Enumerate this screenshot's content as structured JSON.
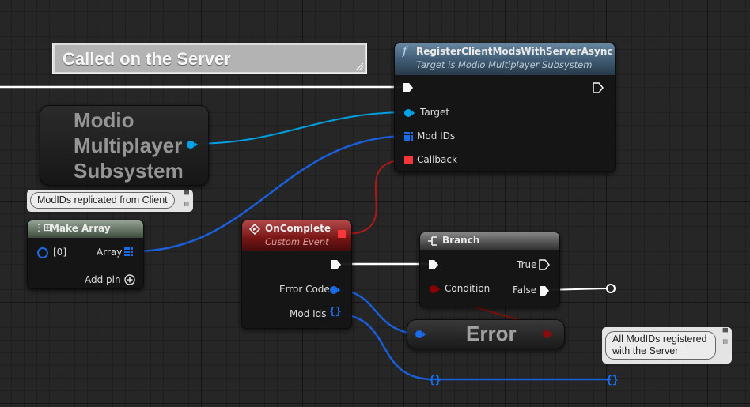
{
  "comment": {
    "title": "Called on the Server"
  },
  "register_node": {
    "title": "RegisterClientModsWithServerAsync",
    "subtitle": "Target is Modio Multiplayer Subsystem",
    "pins": {
      "target": "Target",
      "mod_ids": "Mod IDs",
      "callback": "Callback"
    }
  },
  "subsystem_node": {
    "line1": "Modio",
    "line2": "Multiplayer",
    "line3": "Subsystem"
  },
  "make_array_node": {
    "bubble": "ModIDs replicated from Client",
    "title": "Make Array",
    "pins": {
      "index0": "[0]",
      "array": "Array",
      "add_pin": "Add pin"
    }
  },
  "oncomplete_node": {
    "title": "OnComplete",
    "subtitle": "Custom Event",
    "pins": {
      "error_code": "Error Code",
      "mod_ids": "Mod Ids"
    }
  },
  "branch_node": {
    "title": "Branch",
    "pins": {
      "condition": "Condition",
      "true": "True",
      "false": "False"
    }
  },
  "error_node": {
    "label": "Error"
  },
  "final_bubble": {
    "text_line1": "All ModIDs registered",
    "text_line2": "with the Server"
  },
  "colors": {
    "object_pin": "#00a8f0",
    "array_pin": "#1060f0",
    "delegate_pin": "#ff3838",
    "bool_pin": "#8c0000",
    "exec_wire": "#ffffff"
  }
}
